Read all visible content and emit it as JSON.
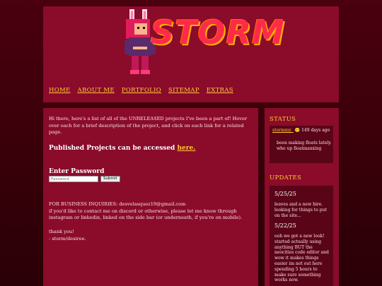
{
  "header": {
    "logo_text": "STORM",
    "nav": [
      "HOME",
      "ABOUT ME",
      "PORTFOLIO",
      "SITEMAP",
      "EXTRAS"
    ]
  },
  "main": {
    "intro": "Hi there, here's a list of all of the UNRELEASED projects I've been a part of! Hover over each for a brief description of the project, and click on each link for a related page.",
    "published_prefix": "Published Projects can be accessed",
    "published_link": "here.",
    "password_heading": "Enter Password",
    "password_placeholder": "Password",
    "submit_label": "Submit",
    "business_line1": "FOR BUSINESS INQUIRIES: desvelasquez19@gmail.com",
    "business_line2": "if you'd like to contact me on discord or otherwise, please let me know through instagram or linkedin, linked on the side bar (or underneath, if you're on mobile).",
    "thanks": "thank you!",
    "signoff": "- storm/desiree."
  },
  "sidebar": {
    "status_heading": "STATUS",
    "status_user": "stormmy_",
    "status_emoji": "🙂",
    "status_time": "149 days ago",
    "status_text": "been making floats lately. who up floatmaxxing",
    "updates_heading": "UPDATES",
    "updates": [
      {
        "date": "5/25/25",
        "text": "leaves and a new hire. looking for things to put on the site..."
      },
      {
        "date": "5/22/25",
        "text": "ooh we got a new look! started actually using anything BUT the neocities code editor and wow it makes things easier im not out here spending 5 hours to make sure something works now."
      }
    ]
  },
  "colors": {
    "page_bg": "#3a0009",
    "panel_bg": "#8a0b2a",
    "inner_box_bg": "#5a0418",
    "accent": "#ffcc33",
    "logo_red": "#ff2a4a"
  }
}
